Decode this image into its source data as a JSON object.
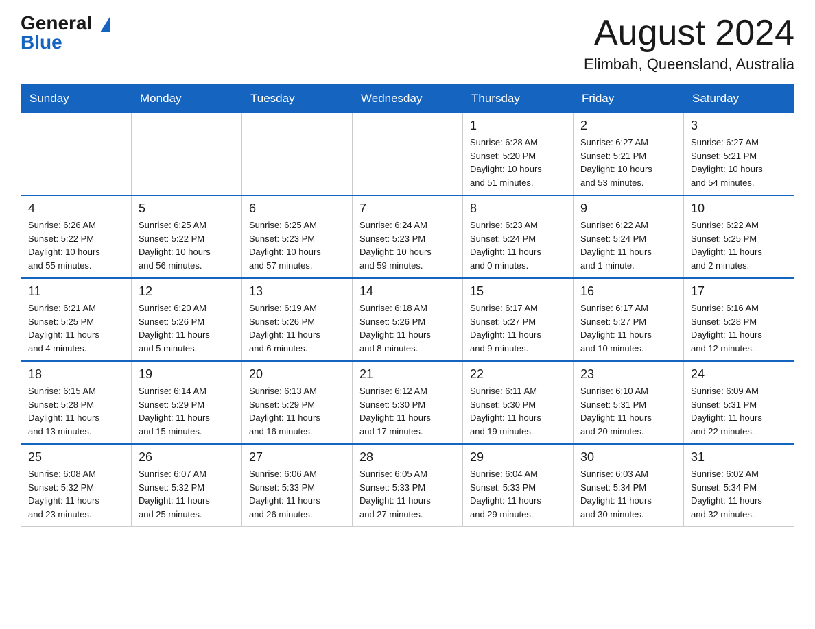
{
  "header": {
    "logo_general": "General",
    "logo_blue": "Blue",
    "month_title": "August 2024",
    "location": "Elimbah, Queensland, Australia"
  },
  "days_of_week": [
    "Sunday",
    "Monday",
    "Tuesday",
    "Wednesday",
    "Thursday",
    "Friday",
    "Saturday"
  ],
  "weeks": [
    [
      {
        "day": "",
        "info": ""
      },
      {
        "day": "",
        "info": ""
      },
      {
        "day": "",
        "info": ""
      },
      {
        "day": "",
        "info": ""
      },
      {
        "day": "1",
        "info": "Sunrise: 6:28 AM\nSunset: 5:20 PM\nDaylight: 10 hours\nand 51 minutes."
      },
      {
        "day": "2",
        "info": "Sunrise: 6:27 AM\nSunset: 5:21 PM\nDaylight: 10 hours\nand 53 minutes."
      },
      {
        "day": "3",
        "info": "Sunrise: 6:27 AM\nSunset: 5:21 PM\nDaylight: 10 hours\nand 54 minutes."
      }
    ],
    [
      {
        "day": "4",
        "info": "Sunrise: 6:26 AM\nSunset: 5:22 PM\nDaylight: 10 hours\nand 55 minutes."
      },
      {
        "day": "5",
        "info": "Sunrise: 6:25 AM\nSunset: 5:22 PM\nDaylight: 10 hours\nand 56 minutes."
      },
      {
        "day": "6",
        "info": "Sunrise: 6:25 AM\nSunset: 5:23 PM\nDaylight: 10 hours\nand 57 minutes."
      },
      {
        "day": "7",
        "info": "Sunrise: 6:24 AM\nSunset: 5:23 PM\nDaylight: 10 hours\nand 59 minutes."
      },
      {
        "day": "8",
        "info": "Sunrise: 6:23 AM\nSunset: 5:24 PM\nDaylight: 11 hours\nand 0 minutes."
      },
      {
        "day": "9",
        "info": "Sunrise: 6:22 AM\nSunset: 5:24 PM\nDaylight: 11 hours\nand 1 minute."
      },
      {
        "day": "10",
        "info": "Sunrise: 6:22 AM\nSunset: 5:25 PM\nDaylight: 11 hours\nand 2 minutes."
      }
    ],
    [
      {
        "day": "11",
        "info": "Sunrise: 6:21 AM\nSunset: 5:25 PM\nDaylight: 11 hours\nand 4 minutes."
      },
      {
        "day": "12",
        "info": "Sunrise: 6:20 AM\nSunset: 5:26 PM\nDaylight: 11 hours\nand 5 minutes."
      },
      {
        "day": "13",
        "info": "Sunrise: 6:19 AM\nSunset: 5:26 PM\nDaylight: 11 hours\nand 6 minutes."
      },
      {
        "day": "14",
        "info": "Sunrise: 6:18 AM\nSunset: 5:26 PM\nDaylight: 11 hours\nand 8 minutes."
      },
      {
        "day": "15",
        "info": "Sunrise: 6:17 AM\nSunset: 5:27 PM\nDaylight: 11 hours\nand 9 minutes."
      },
      {
        "day": "16",
        "info": "Sunrise: 6:17 AM\nSunset: 5:27 PM\nDaylight: 11 hours\nand 10 minutes."
      },
      {
        "day": "17",
        "info": "Sunrise: 6:16 AM\nSunset: 5:28 PM\nDaylight: 11 hours\nand 12 minutes."
      }
    ],
    [
      {
        "day": "18",
        "info": "Sunrise: 6:15 AM\nSunset: 5:28 PM\nDaylight: 11 hours\nand 13 minutes."
      },
      {
        "day": "19",
        "info": "Sunrise: 6:14 AM\nSunset: 5:29 PM\nDaylight: 11 hours\nand 15 minutes."
      },
      {
        "day": "20",
        "info": "Sunrise: 6:13 AM\nSunset: 5:29 PM\nDaylight: 11 hours\nand 16 minutes."
      },
      {
        "day": "21",
        "info": "Sunrise: 6:12 AM\nSunset: 5:30 PM\nDaylight: 11 hours\nand 17 minutes."
      },
      {
        "day": "22",
        "info": "Sunrise: 6:11 AM\nSunset: 5:30 PM\nDaylight: 11 hours\nand 19 minutes."
      },
      {
        "day": "23",
        "info": "Sunrise: 6:10 AM\nSunset: 5:31 PM\nDaylight: 11 hours\nand 20 minutes."
      },
      {
        "day": "24",
        "info": "Sunrise: 6:09 AM\nSunset: 5:31 PM\nDaylight: 11 hours\nand 22 minutes."
      }
    ],
    [
      {
        "day": "25",
        "info": "Sunrise: 6:08 AM\nSunset: 5:32 PM\nDaylight: 11 hours\nand 23 minutes."
      },
      {
        "day": "26",
        "info": "Sunrise: 6:07 AM\nSunset: 5:32 PM\nDaylight: 11 hours\nand 25 minutes."
      },
      {
        "day": "27",
        "info": "Sunrise: 6:06 AM\nSunset: 5:33 PM\nDaylight: 11 hours\nand 26 minutes."
      },
      {
        "day": "28",
        "info": "Sunrise: 6:05 AM\nSunset: 5:33 PM\nDaylight: 11 hours\nand 27 minutes."
      },
      {
        "day": "29",
        "info": "Sunrise: 6:04 AM\nSunset: 5:33 PM\nDaylight: 11 hours\nand 29 minutes."
      },
      {
        "day": "30",
        "info": "Sunrise: 6:03 AM\nSunset: 5:34 PM\nDaylight: 11 hours\nand 30 minutes."
      },
      {
        "day": "31",
        "info": "Sunrise: 6:02 AM\nSunset: 5:34 PM\nDaylight: 11 hours\nand 32 minutes."
      }
    ]
  ]
}
